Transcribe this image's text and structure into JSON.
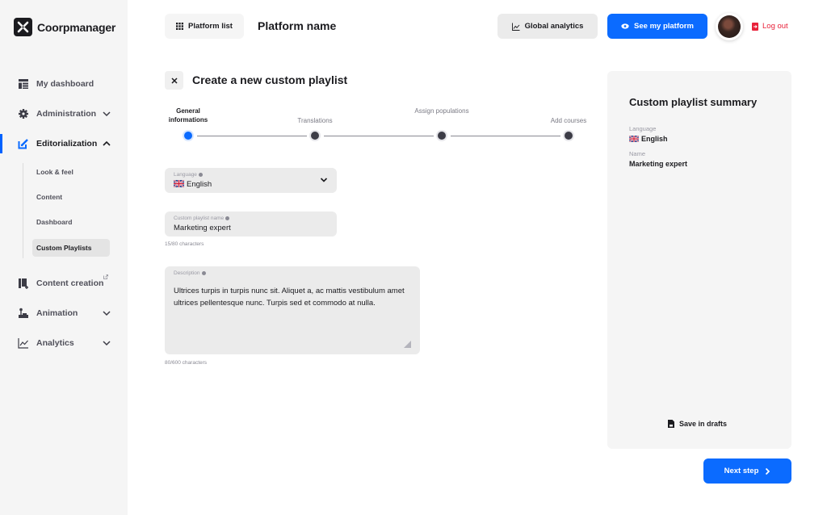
{
  "app": {
    "name": "Coorpmanager"
  },
  "sidebar": {
    "items": [
      {
        "label": "My dashboard",
        "icon": "dashboard-icon"
      },
      {
        "label": "Administration",
        "icon": "gear-icon",
        "expandable": true
      },
      {
        "label": "Editorialization",
        "icon": "edit-icon",
        "expandable": true,
        "expanded": true,
        "active": true
      },
      {
        "label": "Content creation",
        "icon": "books-icon",
        "external": true
      },
      {
        "label": "Animation",
        "icon": "joystick-icon",
        "expandable": true
      },
      {
        "label": "Analytics",
        "icon": "chart-icon",
        "expandable": true
      }
    ],
    "subitems": [
      {
        "label": "Look & feel"
      },
      {
        "label": "Content"
      },
      {
        "label": "Dashboard"
      },
      {
        "label": "Custom Playlists",
        "active": true
      }
    ]
  },
  "header": {
    "platform_list_label": "Platform list",
    "platform_name": "Platform name",
    "global_analytics_label": "Global analytics",
    "see_platform_label": "See my platform",
    "logout_label": "Log out"
  },
  "form": {
    "title": "Create a new custom playlist",
    "steps": [
      {
        "label": "General informations",
        "active": true
      },
      {
        "label": "Translations",
        "active": false
      },
      {
        "label": "Assign populations",
        "active": false
      },
      {
        "label": "Add courses",
        "active": false
      }
    ],
    "language": {
      "label": "Language",
      "value": "English"
    },
    "name": {
      "label": "Custom playlist name",
      "value": "Marketing expert",
      "count": "15/80 characters"
    },
    "description": {
      "label": "Description",
      "value": "Ultrices turpis in turpis nunc sit. Aliquet a, ac mattis vestibulum amet ultrices pellentesque nunc. Turpis sed et commodo at nulla.",
      "count": "80/600 characters"
    }
  },
  "summary": {
    "title": "Custom playlist summary",
    "language_label": "Language",
    "language_value": "English",
    "name_label": "Name",
    "name_value": "Marketing expert",
    "save_drafts_label": "Save in drafts"
  },
  "footer": {
    "next_label": "Next step"
  },
  "colors": {
    "accent": "#0b6bff",
    "danger": "#e8223a",
    "sidebar_bg": "#f5f5f5"
  }
}
